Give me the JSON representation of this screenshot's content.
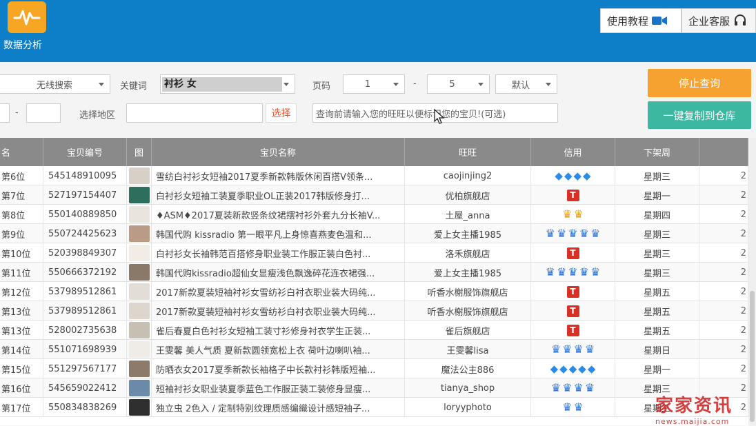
{
  "header": {
    "app_title": "数据分析",
    "tutorial_label": "使用教程",
    "service_label": "企业客服"
  },
  "toolbar": {
    "search_mode": "无线搜索",
    "keyword_label": "关键词",
    "keyword_value": "衬衫 女",
    "page_label": "页码",
    "page_from": "1",
    "page_dash": "-",
    "page_to": "5",
    "sort_value": "默认",
    "range_dash": "-",
    "region_label": "选择地区",
    "region_value": "",
    "select_button": "选择",
    "wangwang_placeholder": "查询前请输入您的旺旺以便标记您的宝贝!(可选)",
    "stop_button": "停止查询",
    "copy_button": "一键复制到仓库"
  },
  "table": {
    "headers": [
      "名",
      "宝贝编号",
      "图",
      "宝贝名称",
      "旺旺",
      "信用",
      "下架周",
      ""
    ],
    "rows": [
      {
        "rank": "第6位",
        "id": "545148910095",
        "name": "雪纺白衬衫女短袖2017夏季新款韩版休闲百搭V领条...",
        "shop": "caojinjing2",
        "credit": {
          "type": "diamond",
          "count": 4
        },
        "week": "星期三",
        "extra": "2",
        "thumb": "#d8cfc7"
      },
      {
        "rank": "第7位",
        "id": "527197154407",
        "name": "白衬衫女短袖工装夏季职业OL正装2017韩版修身打...",
        "shop": "优柏旗舰店",
        "credit": {
          "type": "tmall",
          "count": 1
        },
        "week": "星期一",
        "extra": "2",
        "thumb": "#2e6e5c"
      },
      {
        "rank": "第8位",
        "id": "550140889850",
        "name": "♦ASM♦2017夏装新款竖条纹裙摆衬衫外套九分长袖V...",
        "shop": "土屋_anna",
        "credit": {
          "type": "gold",
          "count": 2
        },
        "week": "星期四",
        "extra": "2",
        "thumb": "#e9e4de"
      },
      {
        "rank": "第9位",
        "id": "550724425623",
        "name": "韩国代购 kissradio 第一眼平凡上身惊喜燕麦色温和...",
        "shop": "爱上女主播1985",
        "credit": {
          "type": "crown",
          "count": 5
        },
        "week": "星期三",
        "extra": "2",
        "thumb": "#b99b86"
      },
      {
        "rank": "第10位",
        "id": "520398849307",
        "name": "白衬衫女长袖韩范百搭修身职业装工作服正装白色衬...",
        "shop": "洛禾旗舰店",
        "credit": {
          "type": "tmall",
          "count": 1
        },
        "week": "星期三",
        "extra": "2",
        "thumb": "#f1ece6"
      },
      {
        "rank": "第11位",
        "id": "550666372192",
        "name": "韩国代购kissradio超仙女显瘦浅色飘逸碎花连衣裙强...",
        "shop": "爱上女主播1985",
        "credit": {
          "type": "crown",
          "count": 5
        },
        "week": "星期三",
        "extra": "2",
        "thumb": "#8a7868"
      },
      {
        "rank": "第12位",
        "id": "537989512861",
        "name": "2017新款夏装短袖衬衫女雪纺衫白衬衣职业装大码纯...",
        "shop": "听香水榭服饰旗舰店",
        "credit": {
          "type": "tmall",
          "count": 1
        },
        "week": "星期五",
        "extra": "2",
        "thumb": "#e2ddd6"
      },
      {
        "rank": "第13位",
        "id": "537989512861",
        "name": "2017新款夏装短袖衬衫女雪纺衫白衬衣职业装大码纯...",
        "shop": "听香水榭服饰旗舰店",
        "credit": {
          "type": "tmall",
          "count": 1
        },
        "week": "星期五",
        "extra": "2",
        "thumb": "#ddd6cc"
      },
      {
        "rank": "第13位",
        "id": "528002735638",
        "name": "雀后春夏白色衬衫女短袖工装寸衫修身衬衣学生正装...",
        "shop": "雀后旗舰店",
        "credit": {
          "type": "tmall",
          "count": 1
        },
        "week": "星期五",
        "extra": "2",
        "thumb": "#c7bfb3"
      },
      {
        "rank": "第14位",
        "id": "551071698939",
        "name": "王雯馨 美人气质 夏新款圆领宽松上衣 荷叶边喇叭袖...",
        "shop": "王雯馨lisa",
        "credit": {
          "type": "crown",
          "count": 4
        },
        "week": "星期日",
        "extra": "2",
        "thumb": "#efebe6"
      },
      {
        "rank": "第15位",
        "id": "551297567177",
        "name": "防晒衣女2017夏季新款长袖格子中长款衬衫韩版短袖...",
        "shop": "魔法公主886",
        "credit": {
          "type": "diamond",
          "count": 5
        },
        "week": "星期一",
        "extra": "2",
        "thumb": "#8d7a6a"
      },
      {
        "rank": "第16位",
        "id": "545659022412",
        "name": "短袖衬衫女职业装夏季蓝色工作服正装工装修身显瘦...",
        "shop": "tianya_shop",
        "credit": {
          "type": "crown",
          "count": 4
        },
        "week": "星期三",
        "extra": "2",
        "thumb": "#6b89a8"
      },
      {
        "rank": "第17位",
        "id": "550834838269",
        "name": "独立虫 2色入 / 定制特别纹理质感编織设计感短袖子...",
        "shop": "loryyphoto",
        "credit": {
          "type": "crown",
          "count": 2
        },
        "week": "星期三",
        "extra": "2",
        "thumb": "#2f2f2f"
      }
    ]
  },
  "watermark": {
    "main": "家家资讯",
    "sub": "news.maijia.com"
  },
  "colors": {
    "header_bg": "#0d7fc8",
    "logo_bg": "#f6a623",
    "stop_button": "#f5a230",
    "copy_button": "#3cb8a0",
    "table_header": "#8a8a8a",
    "tmall_badge": "#d93025"
  },
  "icons": {
    "logo": "pulse-icon",
    "tutorial": "video-camera-icon",
    "service": "headset-icon"
  }
}
